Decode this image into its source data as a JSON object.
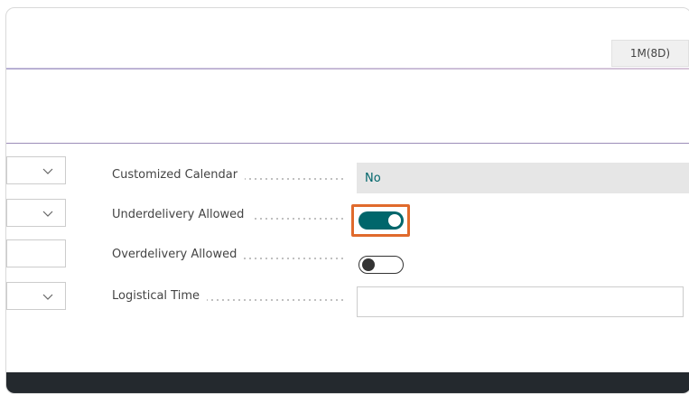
{
  "header": {
    "column_label": "1M(8D)"
  },
  "fields": {
    "customized_calendar": {
      "label": "Customized Calendar",
      "value": "No"
    },
    "underdelivery_allowed": {
      "label": "Underdelivery Allowed",
      "toggle_on": true
    },
    "overdelivery_allowed": {
      "label": "Overdelivery Allowed",
      "toggle_on": false
    },
    "logistical_time": {
      "label": "Logistical Time",
      "value": ""
    }
  },
  "colors": {
    "accent": "#00666b",
    "highlight": "#e06a2c",
    "bottom_bar": "#24292e"
  }
}
